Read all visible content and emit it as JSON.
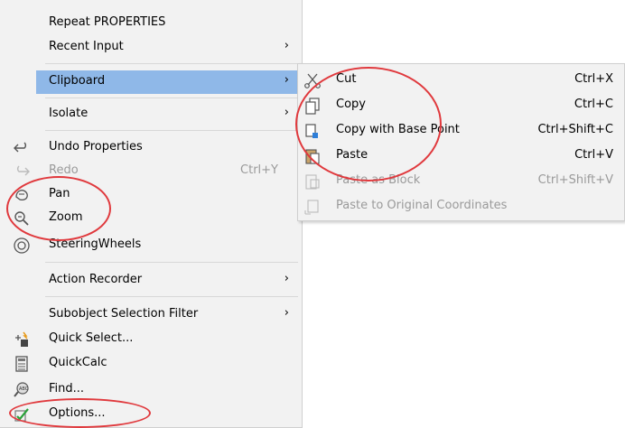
{
  "main_menu": {
    "items": [
      {
        "label": "Repeat PROPERTIES"
      },
      {
        "label": "Recent Input",
        "submenu": true
      },
      {
        "label": "Clipboard",
        "submenu": true,
        "highlighted": true
      },
      {
        "label": "Isolate",
        "submenu": true
      },
      {
        "label": "Undo Properties",
        "icon": "undo-icon"
      },
      {
        "label": "Redo",
        "shortcut": "Ctrl+Y",
        "disabled": true,
        "icon": "redo-icon"
      },
      {
        "label": "Pan",
        "icon": "pan-hand-icon"
      },
      {
        "label": "Zoom",
        "icon": "zoom-icon"
      },
      {
        "label": "SteeringWheels",
        "icon": "steering-wheel-icon"
      },
      {
        "label": "Action Recorder",
        "submenu": true
      },
      {
        "label": "Subobject Selection Filter",
        "submenu": true
      },
      {
        "label": "Quick Select...",
        "icon": "quick-select-icon"
      },
      {
        "label": "QuickCalc",
        "icon": "calculator-icon"
      },
      {
        "label": "Find...",
        "icon": "find-abc-icon"
      },
      {
        "label": "Options...",
        "icon": "options-check-icon"
      }
    ],
    "submenu_glyph": "›"
  },
  "clipboard_submenu": {
    "items": [
      {
        "label": "Cut",
        "shortcut": "Ctrl+X",
        "icon": "scissors-icon"
      },
      {
        "label": "Copy",
        "shortcut": "Ctrl+C",
        "icon": "copy-icon"
      },
      {
        "label": "Copy with Base Point",
        "shortcut": "Ctrl+Shift+C",
        "icon": "copy-base-point-icon"
      },
      {
        "label": "Paste",
        "shortcut": "Ctrl+V",
        "icon": "paste-icon"
      },
      {
        "label": "Paste as Block",
        "shortcut": "Ctrl+Shift+V",
        "disabled": true,
        "icon": "paste-block-icon"
      },
      {
        "label": "Paste to Original Coordinates",
        "disabled": true,
        "icon": "paste-coordinates-icon"
      }
    ]
  },
  "colors": {
    "highlight": "#8fb8e8",
    "menu_bg": "#f2f2f2",
    "annotation": "#e0393d",
    "disabled_text": "#9a9a9a"
  }
}
